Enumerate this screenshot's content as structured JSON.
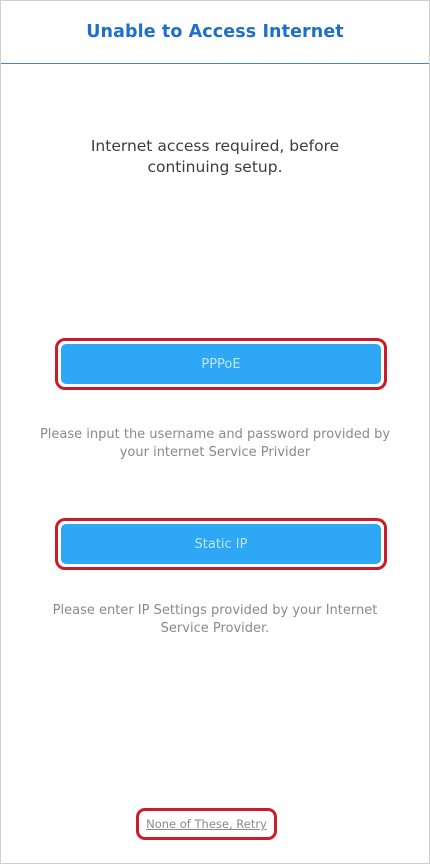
{
  "header": {
    "title": "Unable to Access Internet"
  },
  "intro": {
    "text": "Internet access required, before continuing setup."
  },
  "options": [
    {
      "button_label": "PPPoE",
      "hint": "Please input the username and password provided by your internet Service Privider"
    },
    {
      "button_label": "Static IP",
      "hint": "Please enter IP Settings provided by your Internet Service Provider."
    }
  ],
  "footer": {
    "retry_label": "None of These, Retry"
  },
  "colors": {
    "title": "#1f6fc9",
    "header_rule": "#2f8de0",
    "button_fill": "#2ea8f4",
    "button_text": "#bfe4fb",
    "highlight_outline": "#cc1c2b",
    "hint_text": "#8a8a8a"
  }
}
